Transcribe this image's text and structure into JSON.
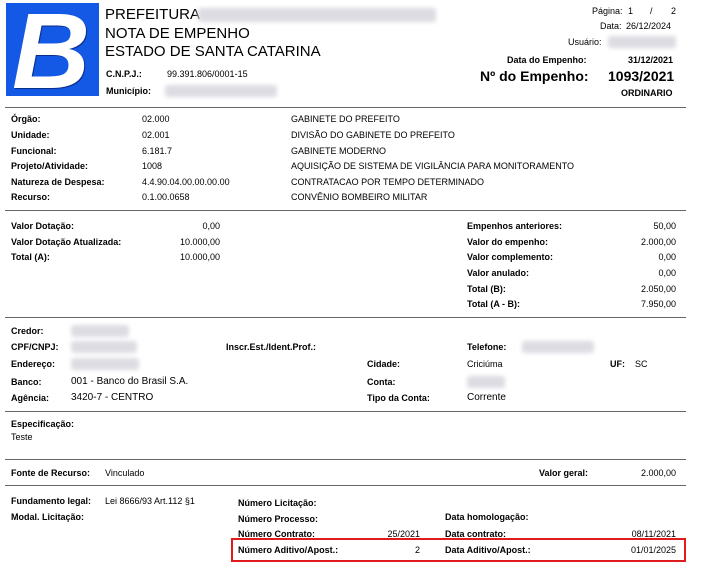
{
  "logo_letter": "B",
  "header": {
    "line1": "PREFEITURA",
    "line2": "NOTA DE EMPENHO",
    "line3": "ESTADO DE SANTA CATARINA",
    "cnpj_label": "C.N.P.J.:",
    "cnpj_value": "99.391.806/0001-15",
    "municipio_label": "Município:"
  },
  "meta": {
    "pagina_label": "Página:",
    "pagina_num": "1",
    "pagina_sep": "/",
    "pagina_total": "2",
    "data_label": "Data:",
    "data_value": "26/12/2024",
    "usuario_label": "Usuário:",
    "data_empenho_label": "Data do Empenho:",
    "data_empenho_value": "31/12/2021",
    "num_empenho_label": "Nº do Empenho:",
    "num_empenho_value": "1093/2021",
    "tipo": "ORDINARIO"
  },
  "classificacao": [
    {
      "label": "Órgão:",
      "code": "02.000",
      "desc": "GABINETE DO PREFEITO"
    },
    {
      "label": "Unidade:",
      "code": "02.001",
      "desc": "DIVISÃO DO GABINETE DO PREFEITO"
    },
    {
      "label": "Funcional:",
      "code": "6.181.7",
      "desc": "GABINETE MODERNO"
    },
    {
      "label": "Projeto/Atividade:",
      "code": "1008",
      "desc": "AQUISIÇÃO DE SISTEMA DE VIGILÂNCIA PARA MONITORAMENTO"
    },
    {
      "label": "Natureza de Despesa:",
      "code": "4.4.90.04.00.00.00.00",
      "desc": "CONTRATACAO POR TEMPO DETERMINADO"
    },
    {
      "label": "Recurso:",
      "code": "0.1.00.0658",
      "desc": "CONVÊNIO BOMBEIRO MILITAR"
    }
  ],
  "valores_left": [
    {
      "label": "Valor Dotação:",
      "value": "0,00"
    },
    {
      "label": "Valor Dotação Atualizada:",
      "value": "10.000,00"
    },
    {
      "label": "Total (A):",
      "value": "10.000,00"
    }
  ],
  "valores_right": [
    {
      "label": "Empenhos anteriores:",
      "value": "50,00"
    },
    {
      "label": "Valor do empenho:",
      "value": "2.000,00"
    },
    {
      "label": "Valor complemento:",
      "value": "0,00"
    },
    {
      "label": "Valor anulado:",
      "value": "0,00"
    },
    {
      "label": "Total (B):",
      "value": "2.050,00"
    },
    {
      "label": "Total (A - B):",
      "value": "7.950,00"
    }
  ],
  "credor": {
    "credor_label": "Credor:",
    "cpf_label": "CPF/CNPJ:",
    "inscr_label": "Inscr.Est./Ident.Prof.:",
    "telefone_label": "Telefone:",
    "endereco_label": "Endereço:",
    "cidade_label": "Cidade:",
    "cidade_value": "Criciúma",
    "uf_label": "UF:",
    "uf_value": "SC",
    "banco_label": "Banco:",
    "banco_value": "001 - Banco do Brasil S.A.",
    "conta_label": "Conta:",
    "agencia_label": "Agência:",
    "agencia_value": "3420-7 - CENTRO",
    "tipo_conta_label": "Tipo da Conta:",
    "tipo_conta_value": "Corrente"
  },
  "especificacao": {
    "label": "Especificação:",
    "value": "Teste"
  },
  "fonte": {
    "label": "Fonte de Recurso:",
    "value": "Vinculado",
    "valor_geral_label": "Valor geral:",
    "valor_geral_value": "2.000,00"
  },
  "fundamento": {
    "fundamento_label": "Fundamento legal:",
    "fundamento_value": "Lei 8666/93 Art.112 §1",
    "modal_label": "Modal. Licitação:",
    "num_licitacao_label": "Número Licitação:",
    "num_processo_label": "Número Processo:",
    "num_contrato_label": "Número Contrato:",
    "num_contrato_value": "25/2021",
    "num_aditivo_label": "Número Aditivo/Apost.:",
    "num_aditivo_value": "2",
    "data_homolog_label": "Data homologação:",
    "data_contrato_label": "Data contrato:",
    "data_contrato_value": "08/11/2021",
    "data_aditivo_label": "Data Aditivo/Apost.:",
    "data_aditivo_value": "01/01/2025"
  }
}
